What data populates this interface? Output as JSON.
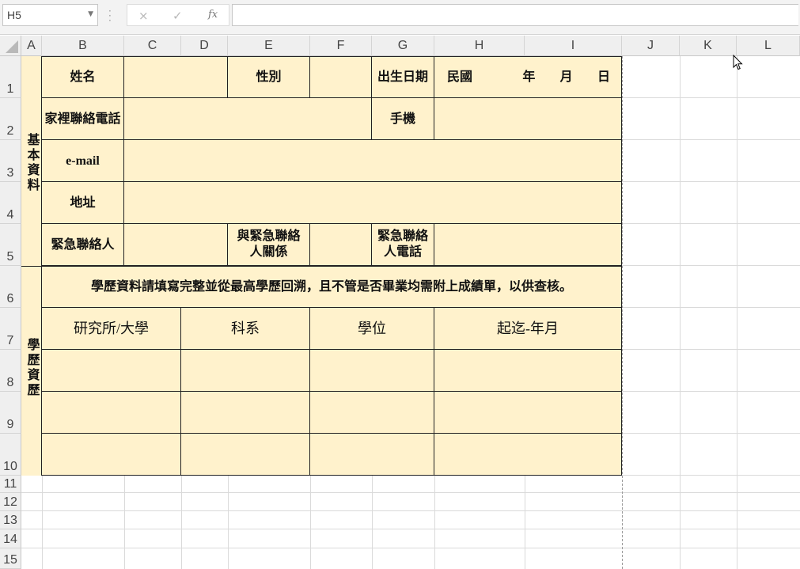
{
  "name_box": {
    "value": "H5"
  },
  "formula_bar": {
    "cancel": "×",
    "enter": "✓",
    "fx": "fx",
    "formula": ""
  },
  "columns": [
    "A",
    "B",
    "C",
    "D",
    "E",
    "F",
    "G",
    "H",
    "I",
    "J",
    "K",
    "L"
  ],
  "rows": [
    "1",
    "2",
    "3",
    "4",
    "5",
    "6",
    "7",
    "8",
    "9",
    "10",
    "11",
    "12",
    "13",
    "14",
    "15"
  ],
  "form": {
    "section_basic": "基本資料",
    "name_label": "姓名",
    "gender_label": "性別",
    "birth_label": "出生日期",
    "birth_era": "民國",
    "birth_year": "年",
    "birth_month": "月",
    "birth_day": "日",
    "home_phone_label": "家裡聯絡電話",
    "mobile_label": "手機",
    "email_label": "e-mail",
    "address_label": "地址",
    "emergency_contact_label": "緊急聯絡人",
    "relation_label_line1": "與緊急聯絡",
    "relation_label_line2": "人關係",
    "emergency_phone_line1": "緊急聯絡",
    "emergency_phone_line2": "人電話",
    "section_education": "學歷資歷",
    "education_note": "學歷資料請填寫完整並從最高學歷回溯，且不管是否畢業均需附上成績單，以供查核。",
    "edu_headers": [
      "研究所/大學",
      "科系",
      "學位",
      "起迄-年月"
    ]
  },
  "colors": {
    "fill": "#fff2cc",
    "border": "#222222",
    "header_bg": "#efefef"
  }
}
